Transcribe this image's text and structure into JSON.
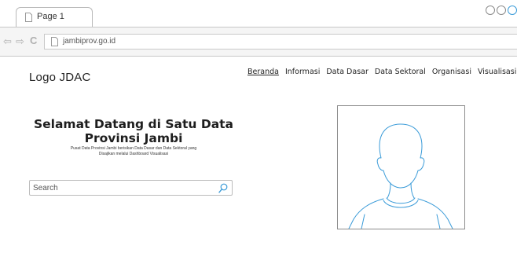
{
  "browser": {
    "tab_title": "Page 1",
    "url": "jambiprov.go.id"
  },
  "site": {
    "logo": "Logo JDAC",
    "nav": {
      "beranda": "Beranda",
      "informasi": "Informasi",
      "data_dasar": "Data Dasar",
      "data_sektoral": "Data Sektoral",
      "organisasi": "Organisasi",
      "visualisasi": "Visualisasi"
    }
  },
  "hero": {
    "title_line1": "Selamat Datang di Satu Data",
    "title_line2": "Provinsi Jambi",
    "subtitle_line1": "Pusat Data Provinsi Jambi berisikan Data Dasar dan Data Sektoral yang",
    "subtitle_line2": "Disajikan melalui Dashboard Visualisasi"
  },
  "search": {
    "placeholder": "Search",
    "icon": "search-icon"
  },
  "illustration": {
    "icon": "person-placeholder-icon",
    "stroke_color": "#3a9bd8"
  },
  "colors": {
    "accent": "#3a9bd8",
    "border": "#8c8c8c"
  }
}
